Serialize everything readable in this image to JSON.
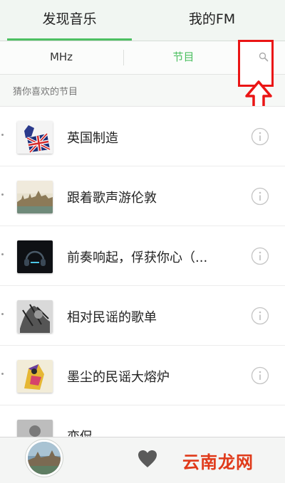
{
  "top_tabs": [
    {
      "label": "发现音乐",
      "active": true
    },
    {
      "label": "我的FM",
      "active": false
    }
  ],
  "sub_tabs": [
    {
      "label": "MHz",
      "active": false
    },
    {
      "label": "节目",
      "active": true
    }
  ],
  "section": {
    "label": "猜你喜欢的节目"
  },
  "programs": [
    {
      "title": "英国制造",
      "thumb_icon": "uk-flag-icon"
    },
    {
      "title": "跟着歌声游伦敦",
      "thumb_icon": "london-cityscape-icon"
    },
    {
      "title": "前奏响起，俘获你心（...",
      "thumb_icon": "headphones-art-icon"
    },
    {
      "title": "相对民谣的歌单",
      "thumb_icon": "sketch-art-icon"
    },
    {
      "title": "墨尘的民谣大熔炉",
      "thumb_icon": "illustration-art-icon"
    },
    {
      "title": "恋侃",
      "thumb_icon": "portrait-art-icon"
    }
  ],
  "player": {
    "avatar_icon": "album-avatar-icon",
    "like_icon": "heart-icon"
  },
  "watermark": {
    "text": "云南龙网"
  },
  "colors": {
    "accent": "#4cbf61",
    "highlight": "#ea1515"
  }
}
